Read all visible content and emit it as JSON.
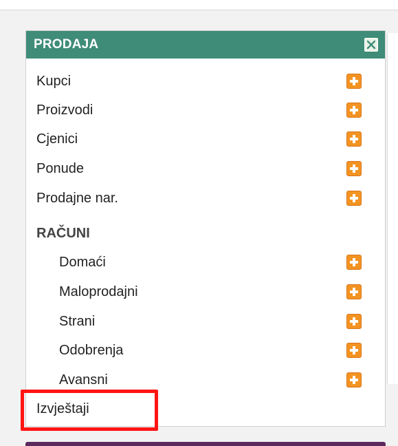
{
  "panel": {
    "title": "PRODAJA",
    "close_icon": "close-icon",
    "header_color": "#3f8c78",
    "plus_icon": "plus-icon",
    "plus_color": "#f39322",
    "items": [
      {
        "label": "Kupci"
      },
      {
        "label": "Proizvodi"
      },
      {
        "label": "Cjenici"
      },
      {
        "label": "Ponude"
      },
      {
        "label": "Prodajne nar."
      }
    ],
    "section": {
      "label": "RAČUNI",
      "items": [
        {
          "label": "Domaći"
        },
        {
          "label": "Maloprodajni"
        },
        {
          "label": "Strani"
        },
        {
          "label": "Odobrenja"
        },
        {
          "label": "Avansni"
        }
      ]
    },
    "reports": {
      "label": "Izvještaji"
    }
  },
  "highlight_color": "#ff1414"
}
